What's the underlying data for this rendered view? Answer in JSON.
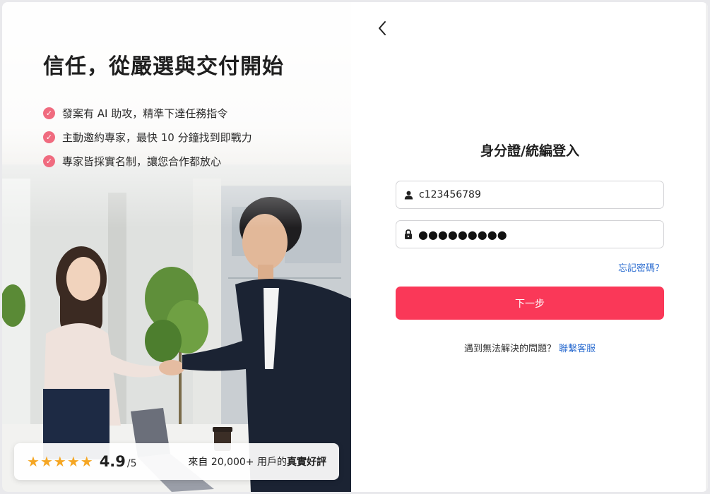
{
  "promo": {
    "headline": "信任，從嚴選與交付開始",
    "features": [
      "發案有 AI 助攻，精準下達任務指令",
      "主動邀約專家，最快 10 分鐘找到即戰力",
      "專家皆採實名制，讓您合作都放心"
    ],
    "rating": {
      "score": "4.9",
      "max": "/5",
      "stars": 5,
      "review_prefix": "來自 20,000+ 用戶的",
      "review_emphasis": "真實好評"
    }
  },
  "login": {
    "back_icon": "chevron-left-icon",
    "title": "身分證/統編登入",
    "id_value": "c123456789",
    "password_mask": "●●●●●●●●●",
    "forgot_label": "忘記密碼？",
    "next_label": "下一步",
    "help_text": "遇到無法解決的問題？",
    "help_link": "聯繫客服"
  },
  "colors": {
    "accent": "#fa3858",
    "link": "#2f6fd1",
    "check": "#f06b7f",
    "star": "#f5a623"
  }
}
